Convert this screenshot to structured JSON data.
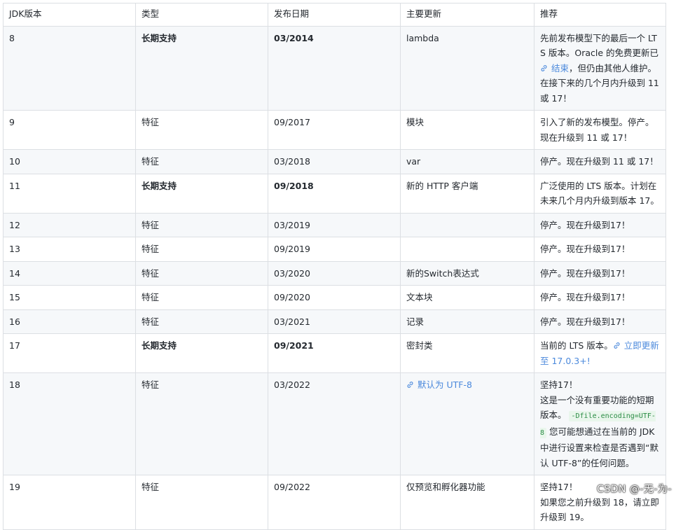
{
  "headers": [
    "JDK版本",
    "类型",
    "发布日期",
    "主要更新",
    "推荐"
  ],
  "rows": [
    {
      "version": "8",
      "type": "长期支持",
      "date": "03/2014",
      "update": "lambda",
      "rec_a": "先前发布模型下的最后一个 LTS 版本。Oracle 的免费更新已 ",
      "rec_link": "结束",
      "rec_b": "，但仍由其他人维护。在接下来的几个月内升级到 11 或 17！"
    },
    {
      "version": "9",
      "type": "特征",
      "date": "09/2017",
      "update": "模块",
      "rec": "引入了新的发布模型。停产。现在升级到 11 或 17！"
    },
    {
      "version": "10",
      "type": "特征",
      "date": "03/2018",
      "update": "var",
      "rec": "停产。现在升级到 11 或 17！"
    },
    {
      "version": "11",
      "type": "长期支持",
      "date": "09/2018",
      "update": "新的 HTTP 客户端",
      "rec": "广泛使用的 LTS 版本。计划在未来几个月内升级到版本 17。"
    },
    {
      "version": "12",
      "type": "特征",
      "date": "03/2019",
      "update": "",
      "rec": "停产。现在升级到17！"
    },
    {
      "version": "13",
      "type": "特征",
      "date": "09/2019",
      "update": "",
      "rec": "停产。现在升级到17！"
    },
    {
      "version": "14",
      "type": "特征",
      "date": "03/2020",
      "update": "新的Switch表达式",
      "rec": "停产。现在升级到17！"
    },
    {
      "version": "15",
      "type": "特征",
      "date": "09/2020",
      "update": "文本块",
      "rec": "停产。现在升级到17！"
    },
    {
      "version": "16",
      "type": "特征",
      "date": "03/2021",
      "update": "记录",
      "rec": "停产。现在升级到17！"
    },
    {
      "version": "17",
      "type": "长期支持",
      "date": "09/2021",
      "update": "密封类",
      "rec_a": "当前的 LTS 版本。",
      "rec_link": "立即更新至 17.0.3+!"
    },
    {
      "version": "18",
      "type": "特征",
      "date": "03/2022",
      "update_link": "默认为 UTF-8",
      "rec_line1": "坚持17！",
      "rec_a": "这是一个没有重要功能的短期版本。 ",
      "rec_code": "-Dfile.encoding=UTF-8",
      "rec_b": " 您可能想通过在当前的 JDK 中进行设置来检查是否遇到“默认 UTF-8”的任何问题。"
    },
    {
      "version": "19",
      "type": "特征",
      "date": "09/2022",
      "update": "仅预览和孵化器功能",
      "rec_line1": "坚持17！",
      "rec_line2": "如果您之前升级到 18，请立即升级到 19。"
    }
  ],
  "watermark": "CSDN @-无-为-",
  "colors": {
    "link": "#4b89dc",
    "code_bg": "#e9f6ec",
    "code_text": "#2a8c45",
    "stripe": "#f6f8fa",
    "border": "#dcdfe3"
  }
}
